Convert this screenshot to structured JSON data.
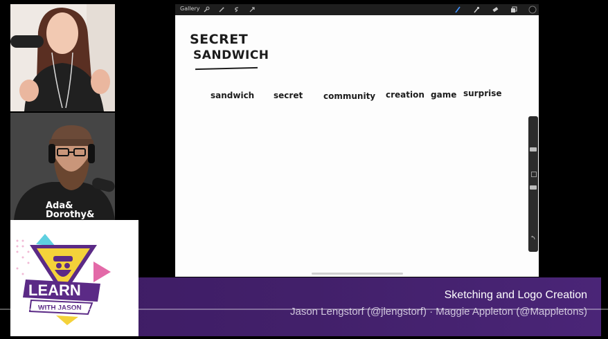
{
  "app": {
    "gallery_label": "Gallery",
    "icons": [
      "wrench-icon",
      "magic-wand-icon",
      "selection-s-icon",
      "transform-arrow-icon",
      "brush-icon",
      "smudge-icon",
      "eraser-icon",
      "layers-icon",
      "color-circle-icon"
    ]
  },
  "canvas": {
    "title_line1": "SECRET",
    "title_line2": "SANDWICH",
    "words": [
      "sandwich",
      "secret",
      "community",
      "creation",
      "game",
      "surprise"
    ]
  },
  "people": {
    "cam2_shirt_line1": "Ada&",
    "cam2_shirt_line2": "Dorothy&"
  },
  "logo": {
    "main": "LEARN",
    "sub": "WITH JASON"
  },
  "lower_third": {
    "title": "Sketching and Logo Creation",
    "subtitle": "Jason Lengstorf (@jlengstorf) · Maggie Appleton (@Mappletons)"
  },
  "colors": {
    "band": "#42206a",
    "accent_yellow": "#f4d23a",
    "accent_purple": "#5b2a86",
    "accent_teal": "#5fd0e0",
    "accent_pink": "#e36aa8"
  }
}
